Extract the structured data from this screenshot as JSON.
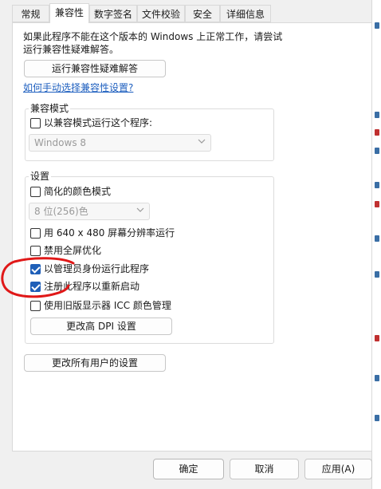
{
  "tabs": [
    {
      "label": "常规",
      "active": false
    },
    {
      "label": "兼容性",
      "active": true
    },
    {
      "label": "数字签名",
      "active": false
    },
    {
      "label": "文件校验",
      "active": false
    },
    {
      "label": "安全",
      "active": false
    },
    {
      "label": "详细信息",
      "active": false
    }
  ],
  "intro": {
    "line1": "如果此程序不能在这个版本的 Windows 上正常工作，请尝试",
    "line2": "运行兼容性疑难解答。"
  },
  "troubleshoot_button": "运行兼容性疑难解答",
  "manual_link": "如何手动选择兼容性设置?",
  "compat_mode": {
    "title": "兼容模式",
    "checkbox_label": "以兼容模式运行这个程序:",
    "checked": false,
    "dropdown_value": "Windows 8"
  },
  "settings": {
    "title": "设置",
    "reduced_color": {
      "label": "简化的颜色模式",
      "checked": false
    },
    "color_dropdown": "8 位(256)色",
    "res_640": {
      "label": "用 640 x 480 屏幕分辨率运行",
      "checked": false
    },
    "disable_fullscreen": {
      "label": "禁用全屏优化",
      "checked": false
    },
    "run_as_admin": {
      "label": "以管理员身份运行此程序",
      "checked": true
    },
    "register_restart": {
      "label": "注册此程序以重新启动",
      "checked": true
    },
    "legacy_icc": {
      "label": "使用旧版显示器 ICC 颜色管理",
      "checked": false
    },
    "dpi_button": "更改高 DPI 设置"
  },
  "all_users_button": "更改所有用户的设置",
  "footer": {
    "ok": "确定",
    "cancel": "取消",
    "apply": "应用(A)"
  },
  "colors": {
    "accent": "#1f5fb8",
    "link": "#1e5fbf",
    "annotation": "#e01818"
  },
  "annotation": {
    "type": "hand-drawn-red-circle",
    "target": "admin-and-restart-checkboxes"
  }
}
